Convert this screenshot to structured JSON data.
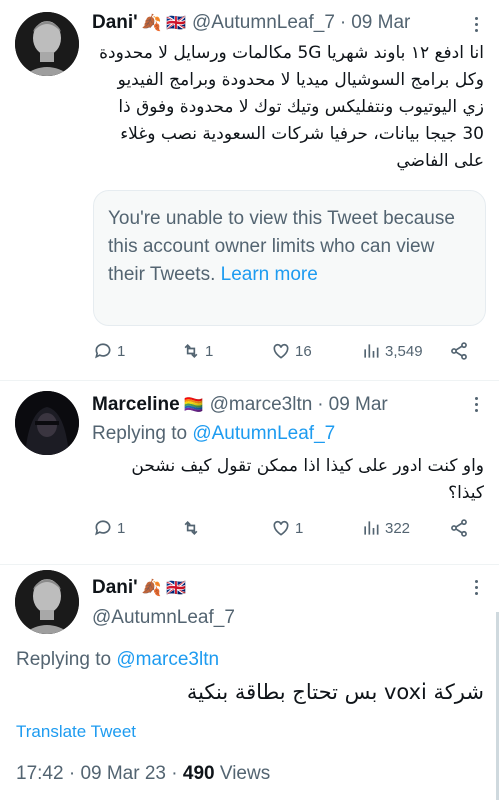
{
  "tweet1": {
    "name": "Dani'",
    "emojis": "🍂 🇬🇧",
    "handle": "@AutumnLeaf_7",
    "dot": "·",
    "date": "09 Mar",
    "text": "انا ادفع ١٢ باوند شهريا 5G مكالمات ورسايل لا محدودة وكل برامج السوشيال ميديا لا محدودة وبرامج الفيديو زي اليوتيوب ونتفليكس وتيك توك لا محدودة وفوق ذا 30 جيجا بيانات، حرفيا شركات السعودية نصب وغلاء على الفاضي",
    "quote": {
      "message": "You're unable to view this Tweet because this account owner limits who can view their Tweets.",
      "link": "Learn more"
    },
    "actions": {
      "replies": "1",
      "retweets": "1",
      "likes": "16",
      "views": "3,549"
    }
  },
  "tweet2": {
    "name": "Marceline",
    "emojis": "🏳️‍🌈",
    "handle": "@marce3ltn",
    "dot": "·",
    "date": "09 Mar",
    "replying_label": "Replying to",
    "replying_handle": "@AutumnLeaf_7",
    "text": "واو كنت ادور على كيذا اذا ممكن تقول كيف نشحن كيذا؟",
    "actions": {
      "replies": "1",
      "retweets": "",
      "likes": "1",
      "views": "322"
    }
  },
  "tweet3": {
    "name": "Dani'",
    "emojis": "🍂 🇬🇧",
    "handle": "@AutumnLeaf_7",
    "replying_label": "Replying to",
    "replying_handle": "@marce3ltn",
    "text": "شركة voxi بس تحتاج بطاقة بنكية",
    "translate": "Translate Tweet",
    "time": "17:42",
    "date": "09 Mar 23",
    "views_count": "490",
    "views_label": "Views"
  },
  "colors": {
    "accent": "#1d9bf0",
    "muted": "#536471",
    "text": "#0f1419"
  }
}
